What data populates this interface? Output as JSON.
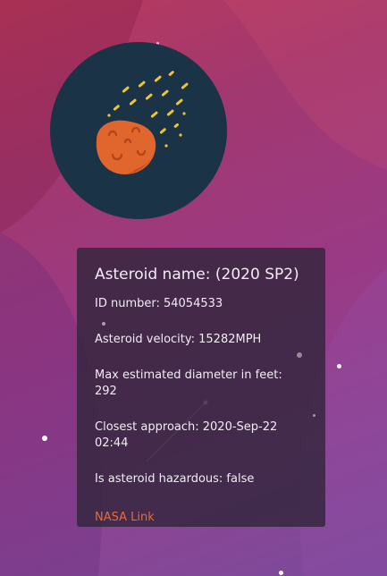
{
  "asteroid": {
    "name_label": "Asteroid name: (2020 SP2)",
    "id_label": "ID number: 54054533",
    "velocity_label": "Asteroid velocity: 15282MPH",
    "diameter_label": "Max estimated diameter in feet: 292",
    "approach_label": "Closest approach: 2020-Sep-22 02:44",
    "hazardous_label": "Is asteroid hazardous: false",
    "nasa_link_label": "NASA Link"
  },
  "icons": {
    "avatar": "asteroid-icon"
  },
  "colors": {
    "link": "#e86a3c",
    "avatar_bg": "#1b3346",
    "asteroid_body": "#e0662e",
    "trail": "#f2c530"
  }
}
